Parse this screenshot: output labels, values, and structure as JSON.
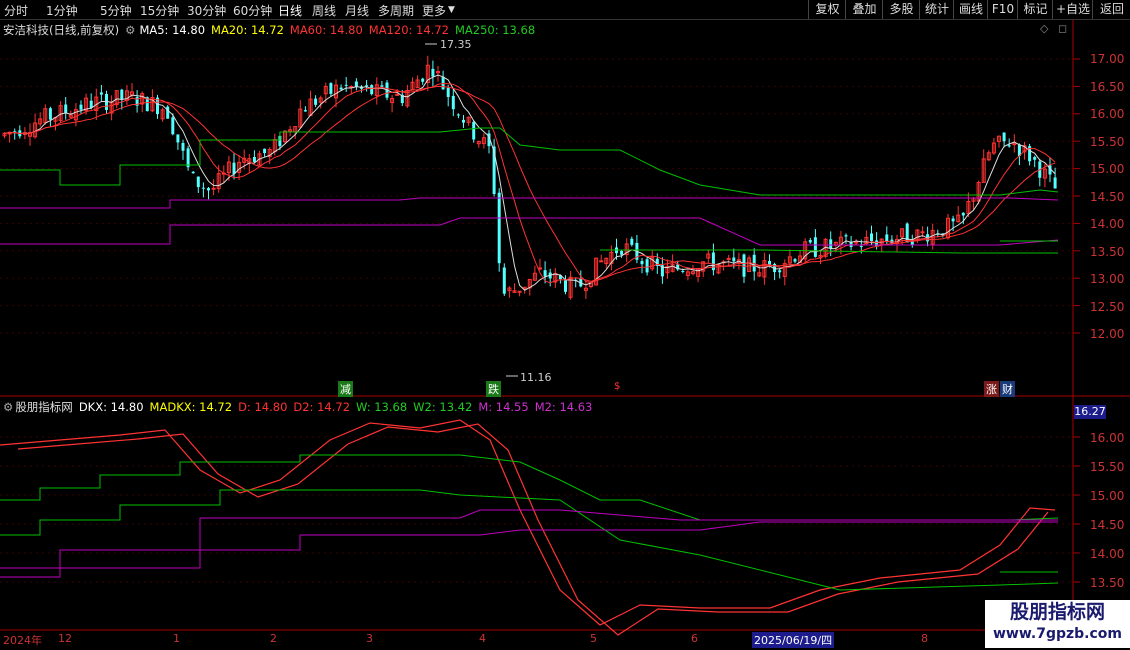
{
  "toolbar": {
    "tabs": [
      "分时",
      "1分钟",
      "5分钟",
      "15分钟",
      "30分钟",
      "60分钟",
      "日线",
      "周线",
      "月线",
      "多周期",
      "更多"
    ],
    "active_tab": "日线",
    "right_buttons": [
      "复权",
      "叠加",
      "多股",
      "统计",
      "画线",
      "F10",
      "标记",
      "+自选",
      "返回"
    ]
  },
  "main_legend": {
    "title": "安洁科技(日线,前复权)",
    "ma5": "MA5: 14.80",
    "ma20": "MA20: 14.72",
    "ma60": "MA60: 14.80",
    "ma120": "MA120: 14.72",
    "ma250": "MA250: 13.68"
  },
  "indicator_legend": {
    "title": "股朋指标网",
    "dkx": "DKX: 14.80",
    "madkx": "MADKX: 14.72",
    "d": "D: 14.80",
    "d2": "D2: 14.72",
    "w": "W: 13.68",
    "w2": "W2: 13.42",
    "m": "M: 14.55",
    "m2": "M2: 14.63"
  },
  "price_axis": [
    "17.00",
    "16.50",
    "16.00",
    "15.50",
    "15.00",
    "14.50",
    "14.00",
    "13.50",
    "13.00",
    "12.50",
    "12.00"
  ],
  "indicator_axis": [
    "16.00",
    "15.50",
    "15.00",
    "14.50",
    "14.00",
    "13.50"
  ],
  "indicator_current": "16.27",
  "high_label": "17.35",
  "low_label": "11.16",
  "markers": {
    "jian": "减",
    "die": "跌",
    "zhang": "涨",
    "cai": "财"
  },
  "x_labels": [
    "2024年",
    "12",
    "1",
    "2",
    "3",
    "4",
    "5",
    "6",
    "2025/06/19/四",
    "8"
  ],
  "watermark": {
    "line1": "股朋指标网",
    "line2": "www.7gpzb.com"
  },
  "colors": {
    "up": "#ff3232",
    "down": "#54ffff",
    "ma5": "#ffffff",
    "ma20": "#ffff00",
    "ma60": "#ff3232",
    "ma250": "#00c000",
    "m": "#c000c0"
  }
}
